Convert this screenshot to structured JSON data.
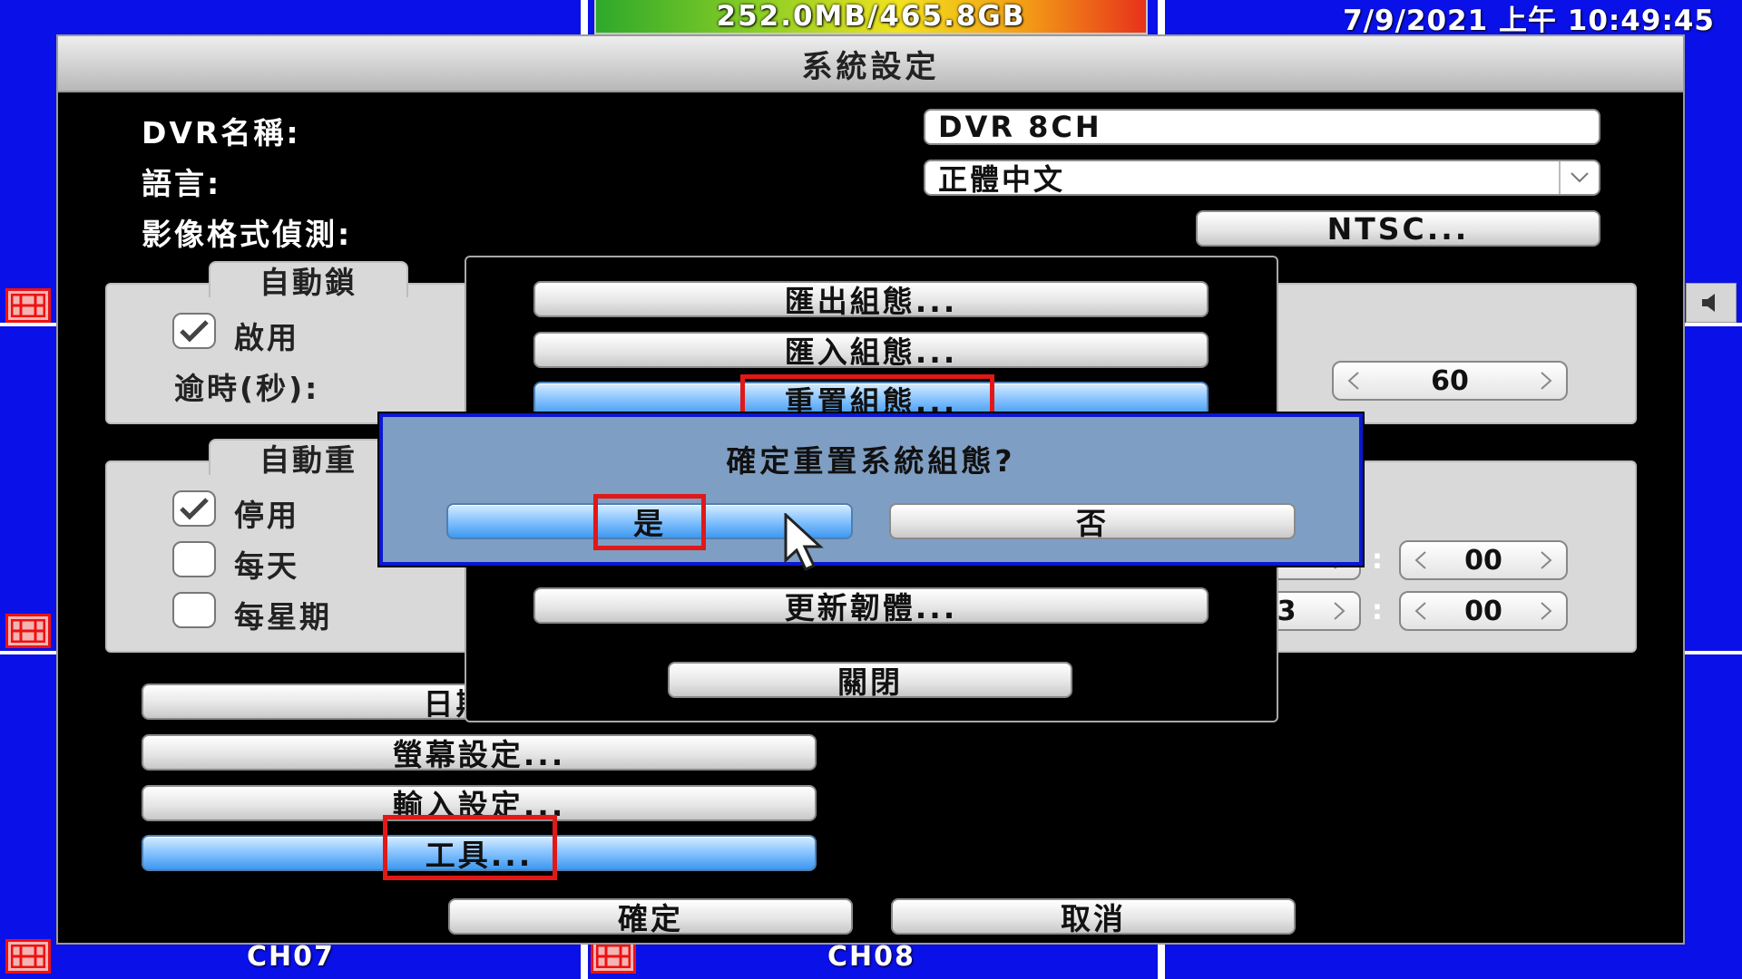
{
  "status_bar": {
    "storage": "252.0MB/465.8GB",
    "datetime": "7/9/2021 上午 10:49:45"
  },
  "channels": {
    "left_label": "CH07",
    "right_label": "CH08"
  },
  "window": {
    "title": "系統設定",
    "dvr_name_label": "DVR名稱:",
    "dvr_name_value": "DVR 8CH",
    "language_label": "語言:",
    "language_value": "正體中文",
    "video_format_label": "影像格式偵測:",
    "video_format_button": "NTSC..."
  },
  "auto_lock": {
    "tab": "自動鎖",
    "enable_label": "啟用",
    "enable_checked": true,
    "timeout_label": "逾時(秒):",
    "timeout_value": "60"
  },
  "auto_reboot": {
    "tab": "自動重",
    "options": [
      {
        "label": "停用",
        "checked": true
      },
      {
        "label": "每天",
        "checked": false
      },
      {
        "label": "每星期",
        "checked": false
      }
    ],
    "time1_hour_partial": "",
    "time1_minute": "00",
    "time2_hour_partial": "3",
    "time2_minute": "00"
  },
  "left_buttons": {
    "datetime": "日期/時",
    "screen_settings": "螢幕設定...",
    "input_settings": "輸入設定...",
    "tools": "工具..."
  },
  "tools_panel": {
    "export_config": "匯出組態...",
    "import_config": "匯入組態...",
    "reset_config": "重置組態...",
    "update_firmware": "更新韌體...",
    "close": "關閉"
  },
  "confirm_dialog": {
    "message": "確定重置系統組態?",
    "yes": "是",
    "no": "否"
  },
  "footer": {
    "ok": "確定",
    "cancel": "取消"
  }
}
